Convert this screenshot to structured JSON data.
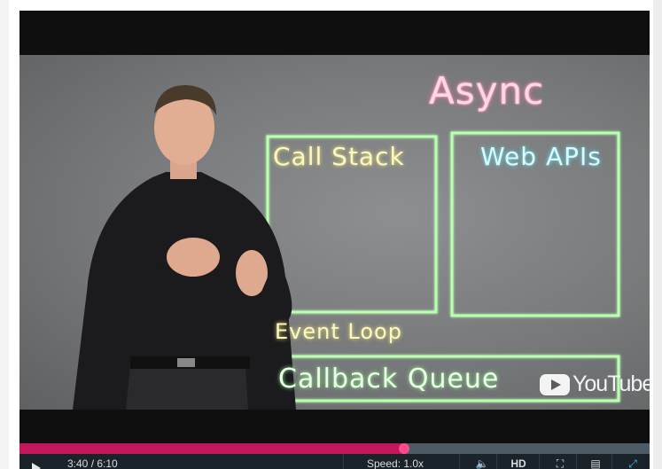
{
  "video": {
    "board": {
      "title": "Async",
      "call_stack_label": "Call Stack",
      "web_apis_label": "Web APIs",
      "event_loop_label": "Event Loop",
      "callback_queue_label": "Callback Queue"
    },
    "watermark_text": "YouTube",
    "icon": "youtube-logo-icon"
  },
  "player": {
    "progress_fraction": 0.61,
    "progress_color": "#c2185b",
    "track_color": "#4c5b66",
    "play_icon": "play-icon",
    "time_display": "3:40 / 6:10",
    "speed_label": "Speed: 1.0x",
    "volume_icon": "volume-icon",
    "quality_label": "HD",
    "fullscreen_icon": "fullscreen-icon",
    "captions_icon": "captions-icon",
    "expand_icon": "expand-icon"
  }
}
